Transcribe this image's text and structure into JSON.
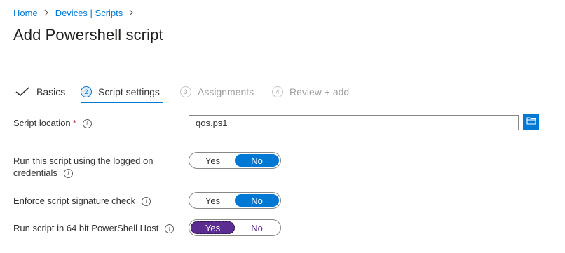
{
  "breadcrumb": {
    "items": [
      "Home",
      "Devices | Scripts"
    ]
  },
  "page": {
    "title": "Add Powershell script"
  },
  "wizard": {
    "tabs": [
      {
        "number": "",
        "label": "Basics",
        "state": "done"
      },
      {
        "number": "2",
        "label": "Script settings",
        "state": "active"
      },
      {
        "number": "3",
        "label": "Assignments",
        "state": "pending"
      },
      {
        "number": "4",
        "label": "Review + add",
        "state": "pending"
      }
    ]
  },
  "form": {
    "script_location": {
      "label": "Script location",
      "required_mark": "*",
      "value": "qos.ps1"
    },
    "run_logged_on": {
      "label_line1": "Run this script using the logged on",
      "label_line2": "credentials",
      "yes": "Yes",
      "no": "No",
      "selected": "No"
    },
    "enforce_signature": {
      "label": "Enforce script signature check",
      "yes": "Yes",
      "no": "No",
      "selected": "No"
    },
    "run_64bit": {
      "label": "Run script in 64 bit PowerShell Host",
      "yes": "Yes",
      "no": "No",
      "selected": "Yes"
    }
  },
  "icons": {
    "info": "info-icon",
    "check": "checkmark-icon",
    "folder": "folder-browse-icon",
    "chevron": "chevron-right-icon"
  },
  "colors": {
    "accent": "#0078d4",
    "toggle_focus": "#5c2d91",
    "required": "#a4262c"
  }
}
